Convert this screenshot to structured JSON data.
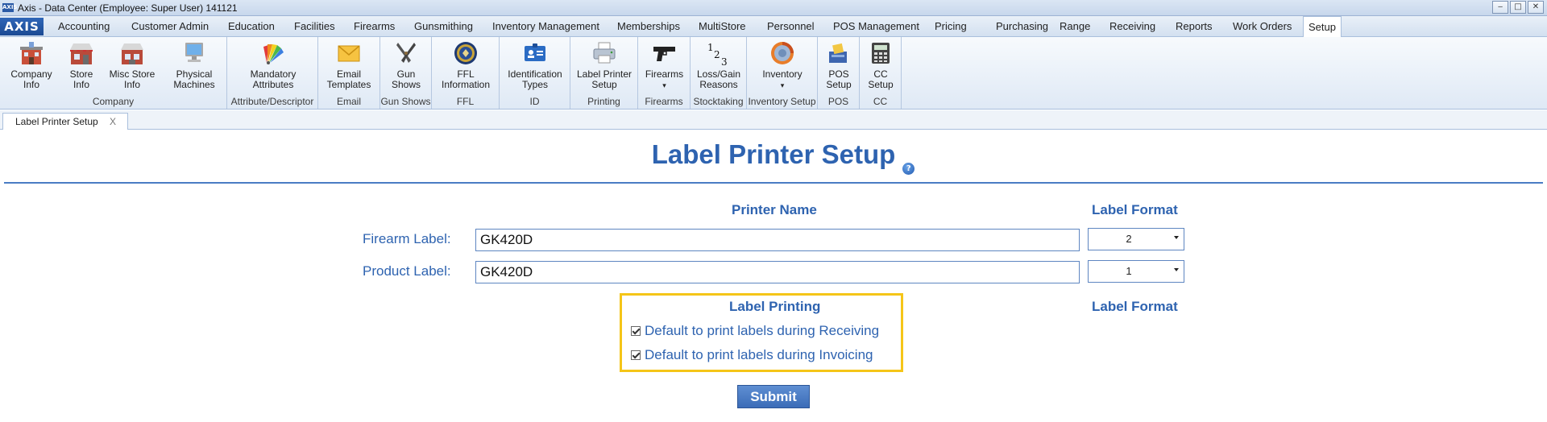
{
  "window": {
    "title": "Axis - Data Center  (Employee: Super User) 141121",
    "logo_small": "AXIS",
    "buttons": [
      "minimize",
      "maximize",
      "close"
    ]
  },
  "menu": {
    "logo": "AXIS",
    "items": [
      "Accounting",
      "Customer Admin",
      "Education",
      "Facilities",
      "Firearms",
      "Gunsmithing",
      "Inventory Management",
      "Memberships",
      "MultiStore",
      "Personnel",
      "POS Management",
      "Pricing",
      "Purchasing",
      "Range",
      "Receiving",
      "Reports",
      "Work Orders",
      "Setup"
    ],
    "active": "Setup"
  },
  "ribbon": {
    "groups": [
      {
        "label": "Company",
        "buttons": [
          {
            "label1": "Company",
            "label2": "Info",
            "icon": "building-icon"
          },
          {
            "label1": "Store",
            "label2": "Info",
            "icon": "store-icon"
          },
          {
            "label1": "Misc Store",
            "label2": "Info",
            "icon": "store-misc-icon"
          },
          {
            "label1": "Physical",
            "label2": "Machines",
            "icon": "computer-icon"
          }
        ]
      },
      {
        "label": "Attribute/Descriptor",
        "buttons": [
          {
            "label1": "Mandatory",
            "label2": "Attributes",
            "icon": "color-fan-icon"
          }
        ]
      },
      {
        "label": "Email",
        "buttons": [
          {
            "label1": "Email",
            "label2": "Templates",
            "icon": "envelope-icon"
          }
        ]
      },
      {
        "label": "Gun Shows",
        "buttons": [
          {
            "label1": "Gun",
            "label2": "Shows",
            "icon": "crossed-pistols-icon"
          }
        ]
      },
      {
        "label": "FFL",
        "buttons": [
          {
            "label1": "FFL",
            "label2": "Information",
            "icon": "seal-icon"
          }
        ]
      },
      {
        "label": "ID",
        "buttons": [
          {
            "label1": "Identification",
            "label2": "Types",
            "icon": "id-card-icon"
          }
        ]
      },
      {
        "label": "Printing",
        "buttons": [
          {
            "label1": "Label Printer",
            "label2": "Setup",
            "icon": "printer-icon"
          }
        ]
      },
      {
        "label": "Firearms",
        "buttons": [
          {
            "label1": "Firearms",
            "label2": "▾",
            "icon": "pistol-icon"
          }
        ]
      },
      {
        "label": "Stocktaking",
        "buttons": [
          {
            "label1": "Loss/Gain",
            "label2": "Reasons",
            "icon": "numbers-icon"
          }
        ]
      },
      {
        "label": "Inventory Setup",
        "buttons": [
          {
            "label1": "Inventory",
            "label2": "▾",
            "icon": "inventory-disc-icon"
          }
        ]
      },
      {
        "label": "POS",
        "buttons": [
          {
            "label1": "POS",
            "label2": "Setup",
            "icon": "pos-icon"
          }
        ]
      },
      {
        "label": "CC",
        "buttons": [
          {
            "label1": "CC",
            "label2": "Setup",
            "icon": "calculator-icon"
          }
        ]
      }
    ]
  },
  "doc_tab": {
    "label": "Label Printer Setup",
    "close": "X"
  },
  "page": {
    "title": "Label Printer Setup",
    "help": "?",
    "headers": {
      "printer_name": "Printer Name",
      "label_format": "Label Format"
    },
    "rows": [
      {
        "label": "Firearm Label:",
        "printer": "GK420D",
        "format": "2"
      },
      {
        "label": "Product Label:",
        "printer": "GK420D",
        "format": "1"
      }
    ],
    "printing": {
      "header": "Label Printing",
      "format_header": "Label Format",
      "options": [
        {
          "label": "Default to print labels during Receiving",
          "checked": true
        },
        {
          "label": "Default to print labels during Invoicing",
          "checked": true
        }
      ]
    },
    "submit": "Submit"
  },
  "colors": {
    "accent": "#2e63b0",
    "highlight": "#f5c518",
    "button": "#3b6cb8"
  }
}
